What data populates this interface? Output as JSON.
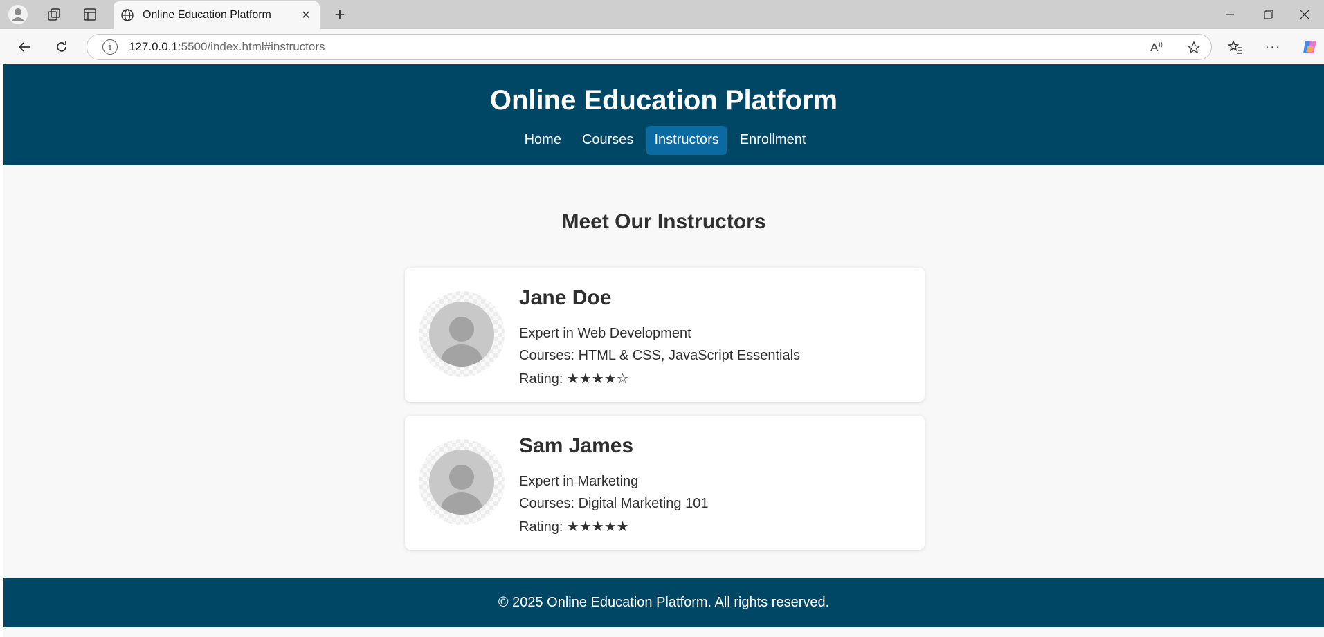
{
  "browser": {
    "tab_title": "Online Education Platform",
    "url_host": "127.0.0.1",
    "url_rest": ":5500/index.html#instructors"
  },
  "site": {
    "title": "Online Education Platform",
    "nav": [
      {
        "label": "Home",
        "active": false
      },
      {
        "label": "Courses",
        "active": false
      },
      {
        "label": "Instructors",
        "active": true
      },
      {
        "label": "Enrollment",
        "active": false
      }
    ]
  },
  "instructors": {
    "heading": "Meet Our Instructors",
    "items": [
      {
        "name": "Jane Doe",
        "expertise": "Expert in Web Development",
        "courses": "Courses: HTML & CSS, JavaScript Essentials",
        "rating": "Rating: ★★★★☆"
      },
      {
        "name": "Sam James",
        "expertise": "Expert in Marketing",
        "courses": "Courses: Digital Marketing 101",
        "rating": "Rating: ★★★★★"
      }
    ]
  },
  "footer": {
    "text": "© 2025 Online Education Platform. All rights reserved."
  },
  "colors": {
    "header_bg": "#004766",
    "active_nav_bg": "#0a6aa1",
    "page_bg": "#f8f8f8"
  }
}
